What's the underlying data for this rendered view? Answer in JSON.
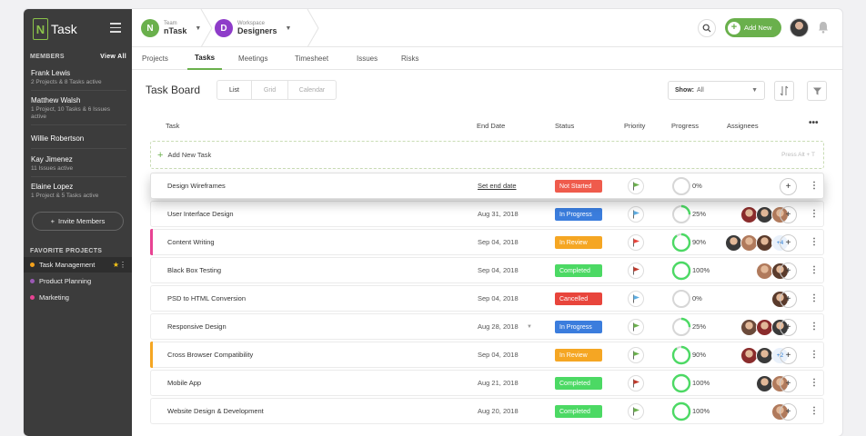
{
  "app": {
    "logo_text": "Task",
    "logo_letter": "N"
  },
  "sidebar": {
    "members_heading": "MEMBERS",
    "view_all": "View All",
    "members": [
      {
        "name": "Frank Lewis",
        "detail": "2 Projects & 8 Tasks active"
      },
      {
        "name": "Matthew Walsh",
        "detail": "1 Project, 10 Tasks & 6 Issues active"
      },
      {
        "name": "Willie Robertson",
        "detail": ""
      },
      {
        "name": "Kay Jimenez",
        "detail": "11 Issues active"
      },
      {
        "name": "Elaine Lopez",
        "detail": "1 Project & 5 Tasks active"
      }
    ],
    "invite_label": "Invite Members",
    "favorites_heading": "FAVORITE PROJECTS",
    "projects": [
      {
        "label": "Task Management",
        "color": "#f4a21c"
      },
      {
        "label": "Product Planning",
        "color": "#9b59b6"
      },
      {
        "label": "Marketing",
        "color": "#e84393"
      }
    ]
  },
  "topbar": {
    "team": {
      "label": "Team",
      "value": "nTask",
      "letter": "N",
      "color": "#6ab04c"
    },
    "workspace": {
      "label": "Workspace",
      "value": "Designers",
      "letter": "D",
      "color": "#8e3cc9"
    },
    "add_new_label": "Add New"
  },
  "tabs": [
    "Projects",
    "Tasks",
    "Meetings",
    "Timesheet",
    "Issues",
    "Risks"
  ],
  "board": {
    "title": "Task Board",
    "views": [
      "List",
      "Grid",
      "Calendar"
    ],
    "show_label": "Show:",
    "show_value": "All",
    "columns": {
      "task": "Task",
      "end_date": "End Date",
      "status": "Status",
      "priority": "Priority",
      "progress": "Progress",
      "assignees": "Assignees"
    },
    "add_task_label": "Add New Task",
    "add_task_hint": "Press Alt + T"
  },
  "tasks": [
    {
      "name": "Design Wireframes",
      "end_date": "Set end date",
      "status": "Not Started",
      "status_color": "#ef5b4c",
      "priority_color": "#6ab04c",
      "progress": "0%",
      "progress_value": 0,
      "assignees": 0,
      "more": "",
      "bar": ""
    },
    {
      "name": "User Interface Design",
      "end_date": "Aug 31, 2018",
      "status": "In Progress",
      "status_color": "#3b7ddd",
      "priority_color": "#5dade2",
      "progress": "25%",
      "progress_value": 25,
      "assignees": 3,
      "more": "",
      "bar": ""
    },
    {
      "name": "Content Writing",
      "end_date": "Sep 04, 2018",
      "status": "In Review",
      "status_color": "#f5a623",
      "priority_color": "#e8453c",
      "progress": "90%",
      "progress_value": 90,
      "assignees": 3,
      "more": "+4",
      "bar": "#e84393"
    },
    {
      "name": "Black Box Testing",
      "end_date": "Sep 04, 2018",
      "status": "Completed",
      "status_color": "#4cd964",
      "priority_color": "#c0392b",
      "progress": "100%",
      "progress_value": 100,
      "assignees": 2,
      "more": "",
      "bar": ""
    },
    {
      "name": "PSD to HTML Conversion",
      "end_date": "Sep 04, 2018",
      "status": "Cancelled",
      "status_color": "#e8453c",
      "priority_color": "#5dade2",
      "progress": "0%",
      "progress_value": 0,
      "assignees": 1,
      "more": "",
      "bar": ""
    },
    {
      "name": "Responsive Design",
      "end_date": "Aug 28, 2018",
      "status": "In Progress",
      "status_color": "#3b7ddd",
      "priority_color": "#6ab04c",
      "progress": "25%",
      "progress_value": 25,
      "assignees": 3,
      "more": "",
      "bar": ""
    },
    {
      "name": "Cross Browser Compatibility",
      "end_date": "Sep 04, 2018",
      "status": "In Review",
      "status_color": "#f5a623",
      "priority_color": "#6ab04c",
      "progress": "90%",
      "progress_value": 90,
      "assignees": 2,
      "more": "+2",
      "bar": "#f5a623"
    },
    {
      "name": "Mobile App",
      "end_date": "Aug 21, 2018",
      "status": "Completed",
      "status_color": "#4cd964",
      "priority_color": "#c0392b",
      "progress": "100%",
      "progress_value": 100,
      "assignees": 2,
      "more": "",
      "bar": ""
    },
    {
      "name": "Website Design & Development",
      "end_date": "Aug 20, 2018",
      "status": "Completed",
      "status_color": "#4cd964",
      "priority_color": "#6ab04c",
      "progress": "100%",
      "progress_value": 100,
      "assignees": 1,
      "more": "",
      "bar": ""
    }
  ]
}
